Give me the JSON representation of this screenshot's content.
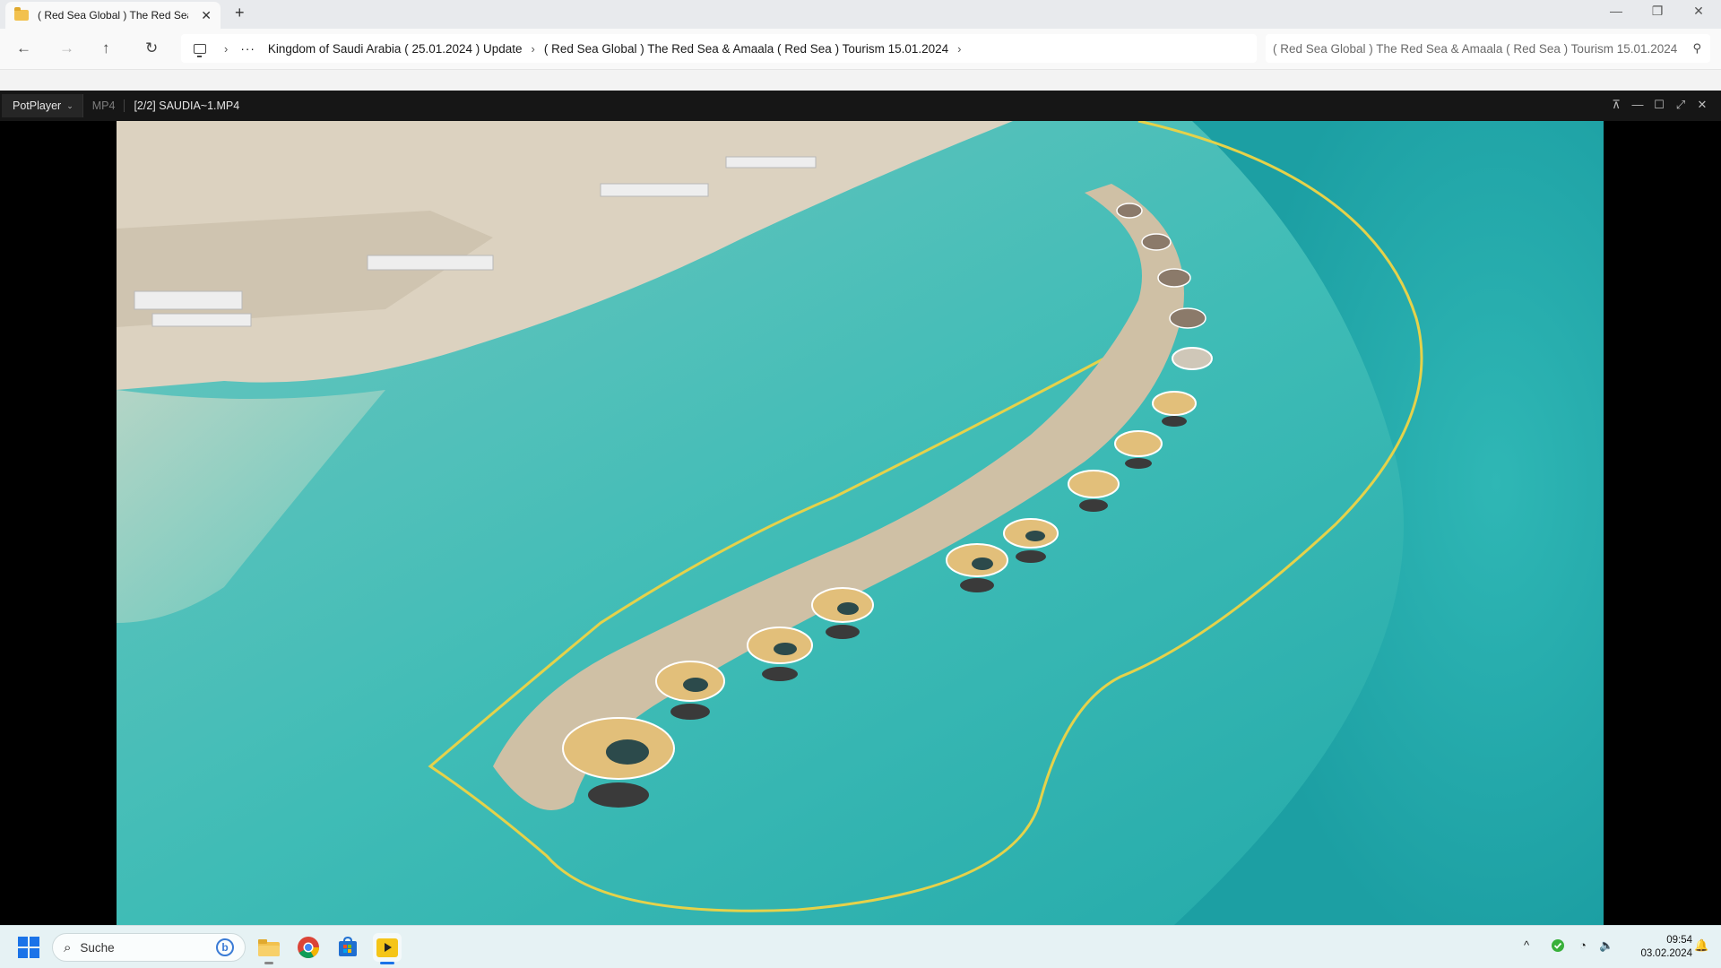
{
  "explorer": {
    "tab_title": "( Red Sea Global ) The Red Sea",
    "tab_close": "✕",
    "new_tab": "+",
    "window_controls": {
      "minimize": "—",
      "restore": "❐",
      "close": "✕"
    },
    "nav": {
      "back": "←",
      "forward": "→",
      "up": "↑",
      "refresh": "↻"
    },
    "breadcrumb": {
      "more": "···",
      "items": [
        "Kingdom of Saudi Arabia ( 25.01.2024 ) Update",
        "( Red Sea Global ) The Red Sea & Amaala ( Red Sea ) Tourism 15.01.2024"
      ],
      "separator": "›"
    },
    "search_text": "( Red Sea Global ) The Red Sea & Amaala ( Red Sea ) Tourism 15.01.2024"
  },
  "potplayer": {
    "menu_label": "PotPlayer",
    "menu_chevron": "⌄",
    "format": "MP4",
    "file": "[2/2] SAUDIA~1.MP4",
    "controls": {
      "pin": "⊼",
      "minimize": "—",
      "maximize": "☐",
      "fullscreen": "⤢",
      "close": "✕"
    }
  },
  "taskbar": {
    "search_placeholder": "Suche",
    "search_icon": "⌕",
    "bing_label": "b",
    "tray": {
      "chevron": "^",
      "wifi": "◔",
      "volume": "🔈",
      "bell": "🔔"
    },
    "time": "09:54",
    "date": "03.02.2024",
    "pinned": [
      "file-explorer-icon",
      "chrome-icon",
      "store-icon",
      "potplayer-icon"
    ]
  }
}
